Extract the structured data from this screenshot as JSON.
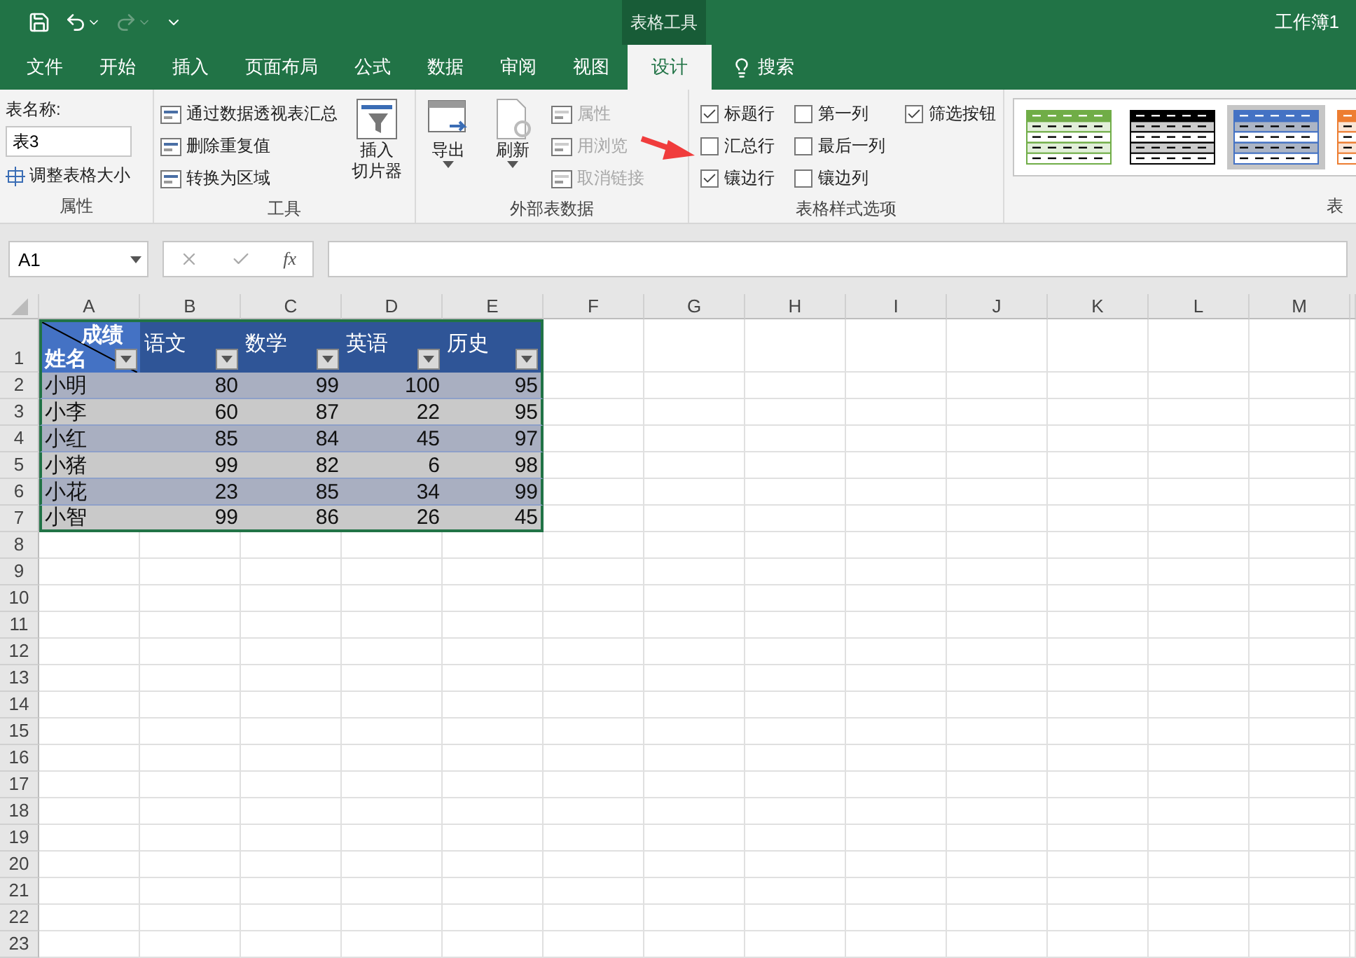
{
  "title_bar": {
    "context_tab": "表格工具",
    "workbook_title": "工作簿1"
  },
  "tabs": [
    {
      "label": "文件",
      "selected": false
    },
    {
      "label": "开始",
      "selected": false
    },
    {
      "label": "插入",
      "selected": false
    },
    {
      "label": "页面布局",
      "selected": false
    },
    {
      "label": "公式",
      "selected": false
    },
    {
      "label": "数据",
      "selected": false
    },
    {
      "label": "审阅",
      "selected": false
    },
    {
      "label": "视图",
      "selected": false
    },
    {
      "label": "设计",
      "selected": true
    }
  ],
  "search": {
    "label": "搜索"
  },
  "ribbon": {
    "properties": {
      "name_label": "表名称:",
      "table_name": "表3",
      "resize_button": "调整表格大小",
      "group_label": "属性"
    },
    "tools": {
      "buttons": [
        "通过数据透视表汇总",
        "删除重复值",
        "转换为区域"
      ],
      "slicer_button": [
        "插入",
        "切片器"
      ],
      "group_label": "工具"
    },
    "external": {
      "export_button": "导出",
      "refresh_button": "刷新",
      "small_buttons": [
        {
          "label": "属性",
          "disabled": true
        },
        {
          "label": "用浏览",
          "disabled": true
        },
        {
          "label": "取消链接",
          "disabled": true
        }
      ],
      "group_label": "外部表数据"
    },
    "style_options": {
      "columns": [
        [
          {
            "label": "标题行",
            "checked": true
          },
          {
            "label": "汇总行",
            "checked": false
          },
          {
            "label": "镶边行",
            "checked": true
          }
        ],
        [
          {
            "label": "第一列",
            "checked": false
          },
          {
            "label": "最后一列",
            "checked": false
          },
          {
            "label": "镶边列",
            "checked": false
          }
        ],
        [
          {
            "label": "筛选按钮",
            "checked": true
          }
        ]
      ],
      "group_label": "表格样式选项"
    },
    "styles": {
      "swatches": [
        {
          "color": "#70ad47",
          "selected": false
        },
        {
          "color": "#000000",
          "selected": false
        },
        {
          "color": "#4472c4",
          "selected": true
        },
        {
          "color": "#ed7d31",
          "selected": false
        }
      ],
      "group_label": "表"
    }
  },
  "formula_bar": {
    "name_box": "A1",
    "function_label": "fx"
  },
  "sheet": {
    "columns": [
      "A",
      "B",
      "C",
      "D",
      "E",
      "F",
      "G",
      "H",
      "I",
      "J",
      "K",
      "L",
      "M"
    ],
    "row_numbers": [
      "1",
      "2",
      "3",
      "4",
      "5",
      "6",
      "7",
      "8",
      "9",
      "10",
      "11",
      "12",
      "13",
      "14",
      "15",
      "16",
      "17",
      "18",
      "19",
      "20",
      "21",
      "22",
      "23"
    ],
    "table": {
      "corner_top": "成绩",
      "corner_bottom": "姓名",
      "headers": [
        "语文",
        "数学",
        "英语",
        "历史"
      ],
      "rows": [
        [
          "小明",
          "80",
          "99",
          "100",
          "95"
        ],
        [
          "小李",
          "60",
          "87",
          "22",
          "95"
        ],
        [
          "小红",
          "85",
          "84",
          "45",
          "97"
        ],
        [
          "小猪",
          "99",
          "82",
          "6",
          "98"
        ],
        [
          "小花",
          "23",
          "85",
          "34",
          "99"
        ],
        [
          "小智",
          "99",
          "86",
          "26",
          "45"
        ]
      ]
    }
  },
  "annotation": {
    "kind": "arrow",
    "color": "#f03c3c"
  }
}
